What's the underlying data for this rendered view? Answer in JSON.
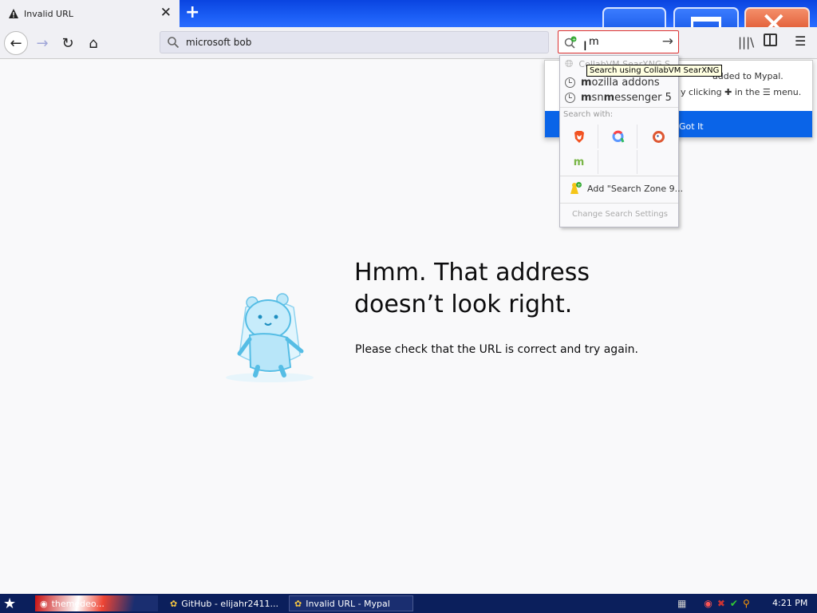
{
  "tab": {
    "title": "Invalid URL",
    "close": "✕",
    "new_tab": "+"
  },
  "nav": {
    "url_value": "microsoft bob",
    "search_value": "m",
    "search_go": "→"
  },
  "notification": {
    "line1": "added to Mypal.",
    "line2_a": "y clicking",
    "line2_b": "in the",
    "line2_c": "menu.",
    "button": "Got It"
  },
  "search_dropdown": {
    "first_suggestion": "CollabVM SearXNG S...",
    "suggestions": [
      {
        "bold": "m",
        "rest": "ozilla addons"
      },
      {
        "bold": "m",
        "rest": "sn ",
        "bold2": "m",
        "rest2": "essenger 5"
      }
    ],
    "search_with_label": "Search with:",
    "engines": [
      "brave",
      "qwant",
      "duckduckgo",
      "mojeek"
    ],
    "add_search": "Add \"Search Zone 9...",
    "change_settings": "Change Search Settings"
  },
  "tooltip": "Search using CollabVM SearXNG",
  "error": {
    "title": "Hmm. That address doesn’t look right.",
    "description": "Please check that the URL is correct and try again."
  },
  "taskbar": {
    "items": [
      "themedeo...",
      "GitHub - elijahr2411...",
      "Invalid URL - Mypal"
    ],
    "clock": "4:21 PM"
  },
  "colors": {
    "titlebar": "#1b5ef5",
    "taskbar": "#0b1f5c",
    "notif_button": "#0a64e8"
  }
}
